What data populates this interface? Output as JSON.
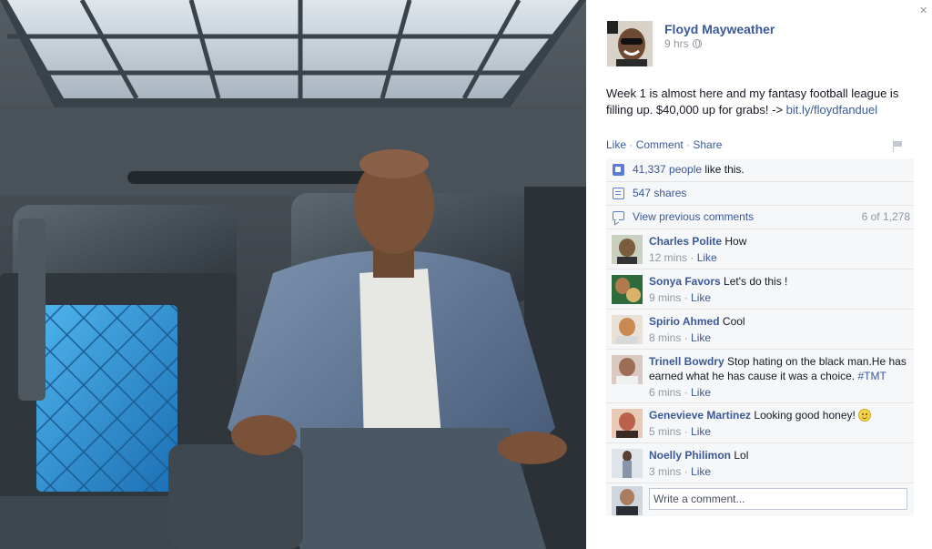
{
  "panel": {
    "close_glyph": "×",
    "author": {
      "name": "Floyd Mayweather",
      "time": "9 hrs",
      "privacy_icon": "globe-icon"
    },
    "post": {
      "text": "Week 1 is almost here and my fantasy football league is filling up. $40,000 up for grabs! ->",
      "link": "bit.ly/floydfanduel"
    },
    "actions": {
      "like": "Like",
      "comment": "Comment",
      "share": "Share",
      "separator": " · "
    },
    "likes": {
      "count": "41,337 people",
      "suffix": " like this."
    },
    "shares": {
      "label": "547 shares"
    },
    "view_previous": {
      "label": "View previous comments",
      "count": "6 of 1,278"
    },
    "comments": [
      {
        "name": "Charles Polite",
        "text": "How",
        "time": "12 mins",
        "like": "Like",
        "avatar_color": "#7a5c3e"
      },
      {
        "name": "Sonya Favors",
        "text": "Let's do this !",
        "time": "9 mins",
        "like": "Like",
        "avatar_color": "#b07a4f"
      },
      {
        "name": "Spirio Ahmed",
        "text": "Cool",
        "time": "8 mins",
        "like": "Like",
        "avatar_color": "#c98a52"
      },
      {
        "name": "Trinell Bowdry",
        "text": "Stop hating on the black man.He has earned what he has cause it was a choice.",
        "hashtag": "#TMT",
        "time": "6 mins",
        "like": "Like",
        "avatar_color": "#9c6e55"
      },
      {
        "name": "Genevieve Martinez",
        "text": "Looking good honey!",
        "time": "5 mins",
        "like": "Like",
        "avatar_color": "#b9614a"
      },
      {
        "name": "Noelly Philimon",
        "text": "Lol",
        "time": "3 mins",
        "like": "Like",
        "avatar_color": "#8895a8"
      }
    ],
    "write_comment": {
      "placeholder": "Write a comment..."
    }
  },
  "colors": {
    "link": "#3b5998",
    "meta": "#9197a3",
    "ufi_bg": "#f6f7f8",
    "seat_blue": "#2f8fd8"
  }
}
